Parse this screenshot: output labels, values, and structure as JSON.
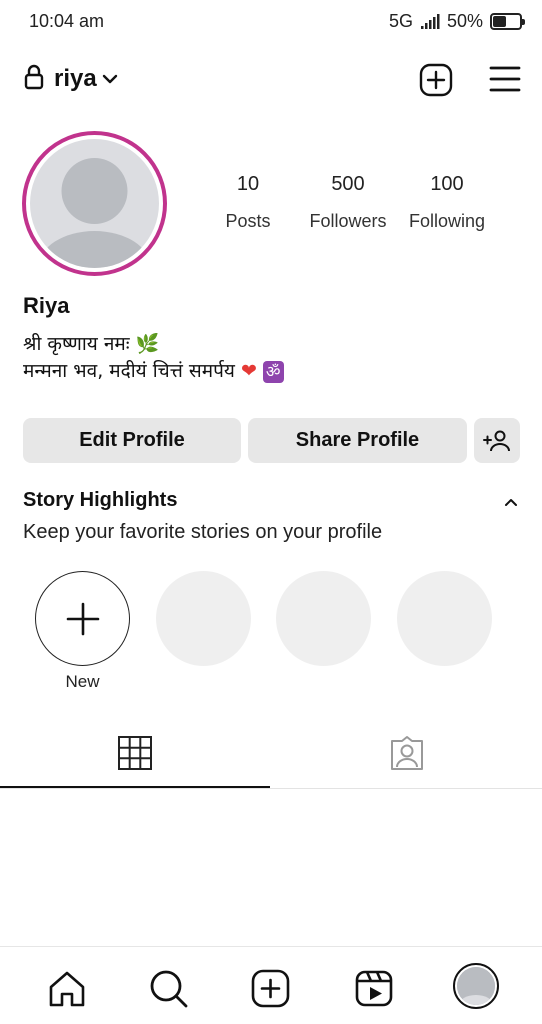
{
  "status": {
    "time": "10:04 am",
    "network": "5G",
    "battery": "50%",
    "battery_level": 0.5
  },
  "header": {
    "username": "riya",
    "icons": [
      "lock-icon",
      "chevron-down-icon",
      "new-post-icon",
      "menu-icon"
    ]
  },
  "profile": {
    "stats": [
      {
        "value": "10",
        "label": "Posts"
      },
      {
        "value": "500",
        "label": "Followers"
      },
      {
        "value": "100",
        "label": "Following"
      }
    ],
    "name": "Riya",
    "bio_line1": "श्री कृष्णाय नमः",
    "bio_line1_emoji": "🌿",
    "bio_line2": "मन्मना भव, मदीयं चित्तं समर्पय",
    "bio_line2_emoji_heart": "❤",
    "bio_line2_emoji_om": "ॐ"
  },
  "actions": {
    "edit_label": "Edit Profile",
    "share_label": "Share Profile"
  },
  "highlights": {
    "title": "Story Highlights",
    "subtitle": "Keep your favorite stories on your profile",
    "new_label": "New"
  },
  "tabs": [
    "grid-icon",
    "tagged-icon"
  ],
  "bottom_nav": [
    "home-icon",
    "search-icon",
    "create-icon",
    "reels-icon",
    "profile-avatar"
  ],
  "colors": {
    "story_ring": "#c1338d",
    "button_bg": "#e7e7e7",
    "placeholder": "#efefef"
  }
}
